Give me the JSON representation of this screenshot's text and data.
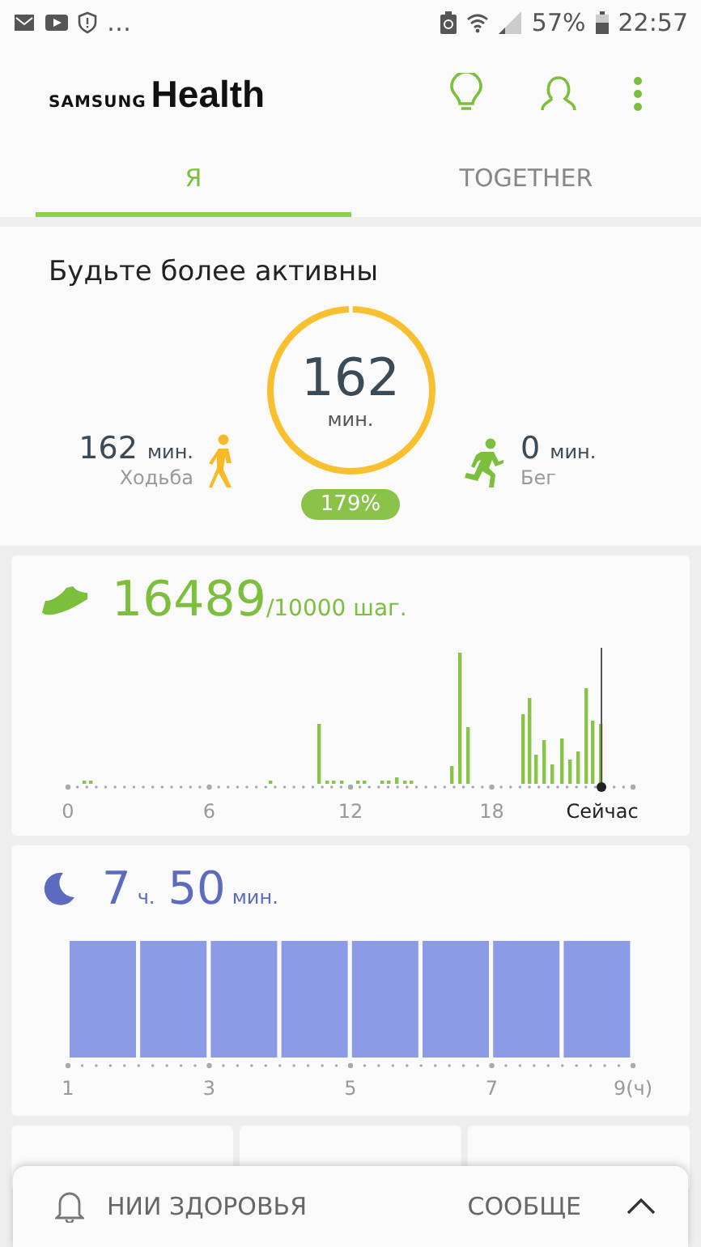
{
  "status_bar": {
    "more": "…",
    "battery": "57%",
    "time": "22:57"
  },
  "app_bar": {
    "brand": "SAMSUNG",
    "title": "Health"
  },
  "tabs": [
    {
      "label": "Я",
      "selected": true
    },
    {
      "label": "TOGETHER",
      "selected": false
    }
  ],
  "activity": {
    "title": "Будьте более активны",
    "total": "162",
    "total_unit": "мин.",
    "percent": "179%",
    "items": [
      {
        "kind": "walk",
        "value": "162",
        "unit": "мин.",
        "label": "Ходьба"
      },
      {
        "kind": "run",
        "value": "0",
        "unit": "мин.",
        "label": "Бег"
      }
    ]
  },
  "steps": {
    "value": "16489",
    "goal": "/10000 шаг.",
    "axis": [
      "0",
      "6",
      "12",
      "18"
    ],
    "now": "Сейчас"
  },
  "sleep": {
    "hours": "7",
    "hours_unit": "ч.",
    "minutes": "50",
    "minutes_unit": "мин.",
    "axis": [
      "1",
      "3",
      "5",
      "7",
      "9(ч)"
    ]
  },
  "bottom_bar": {
    "left": "НИИ ЗДОРОВЬЯ",
    "right": "СООБЩЕ"
  }
}
